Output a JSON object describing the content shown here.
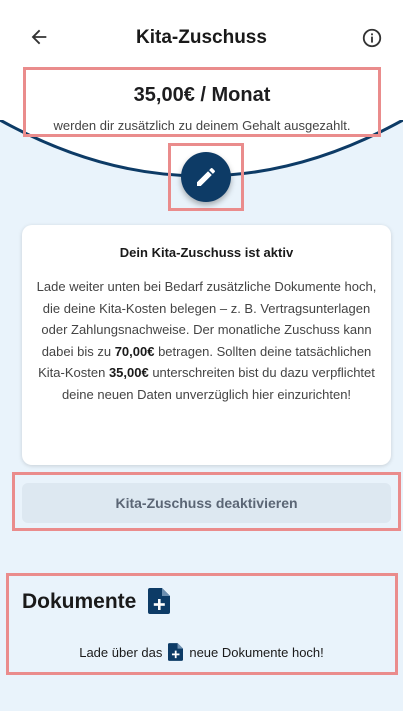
{
  "header": {
    "title": "Kita-Zuschuss",
    "back_icon": "arrow-left-icon",
    "info_icon": "info-icon"
  },
  "summary": {
    "amount": "35,00€ / Monat",
    "subtitle": "werden dir zusätzlich zu deinem Gehalt ausgezahlt."
  },
  "edit_button": {
    "icon": "pencil-icon"
  },
  "info_card": {
    "title": "Dein Kita-Zuschuss ist aktiv",
    "body_part1": "Lade weiter unten bei Bedarf zusätzliche Dokumente hoch, die deine Kita-Kosten belegen – z. B. Vertragsunterlagen oder Zahlungsnachweise. Der monatliche Zuschuss kann dabei bis zu ",
    "max_amount": "70,00€",
    "body_part2": " betragen. Sollten deine tatsächlichen Kita-Kosten ",
    "current_amount": "35,00€",
    "body_part3": " unterschreiten bist du dazu verpflichtet deine neuen Daten unverzüglich hier einzurichten!"
  },
  "deactivate_button": {
    "label": "Kita-Zuschuss deaktivieren"
  },
  "documents": {
    "title": "Dokumente",
    "add_icon": "file-plus-icon",
    "hint_before": "Lade über das",
    "hint_after": "neue Dokumente hoch!"
  },
  "colors": {
    "primary": "#0d3b66",
    "background": "#e9f3fb",
    "highlight": "#ea8c8c",
    "button_bg": "#dde8f1"
  }
}
